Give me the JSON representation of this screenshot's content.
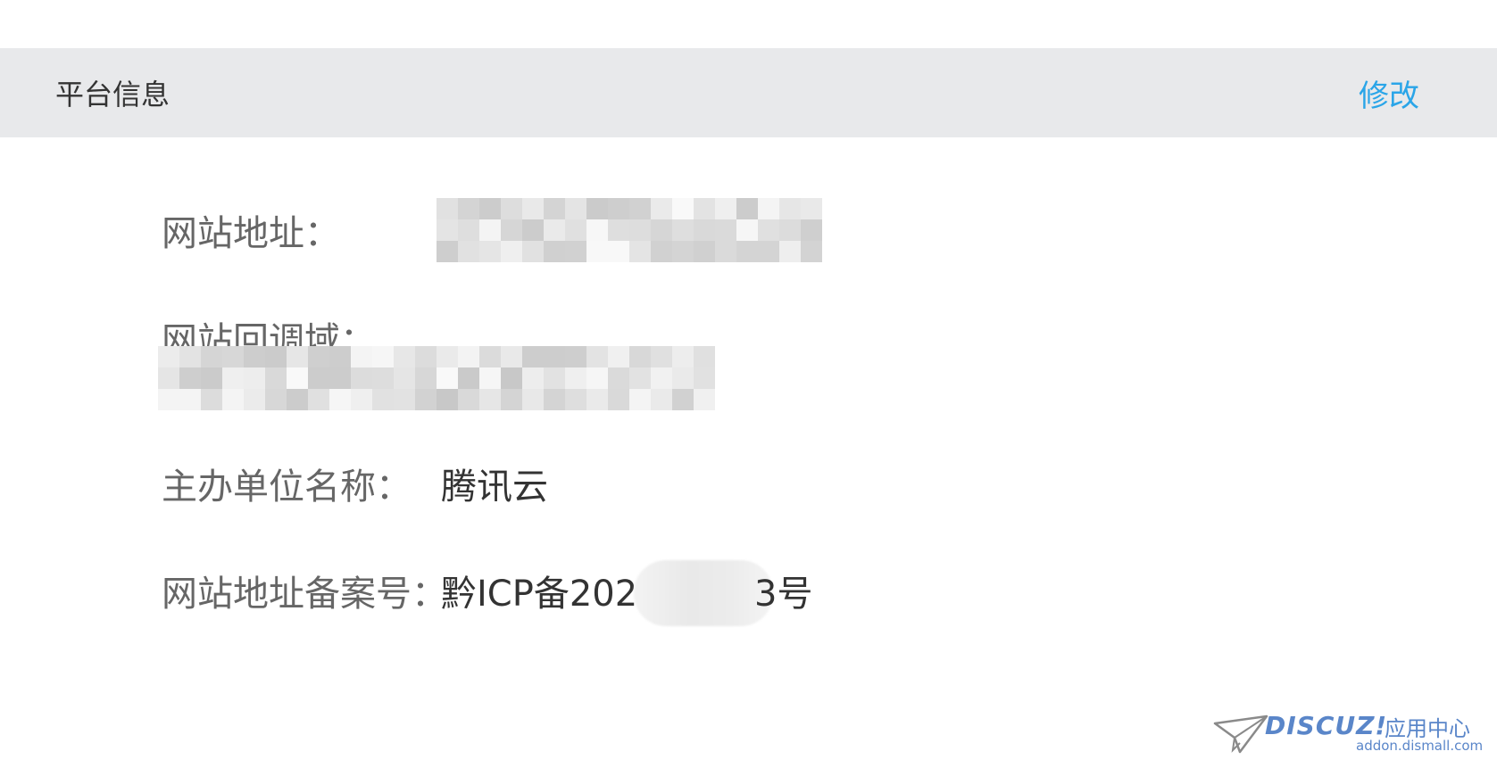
{
  "header": {
    "title": "平台信息",
    "edit_label": "修改"
  },
  "fields": {
    "site_url_label": "网站地址：",
    "callback_domain_label": "网站回调域：",
    "organizer_label": "主办单位名称：",
    "organizer_value": "腾讯云",
    "icp_label": "网站地址备案号：",
    "icp_value_prefix": "黔ICP备202",
    "icp_value_suffix": "3号"
  },
  "watermark": {
    "brand": "DISCUZ!",
    "center": "应用中心",
    "url": "addon.dismall.com"
  },
  "colors": {
    "header_bg": "#e8e9eb",
    "link": "#2aa5e8",
    "label": "#666666",
    "value": "#333333",
    "watermark": "#5a86c9"
  }
}
